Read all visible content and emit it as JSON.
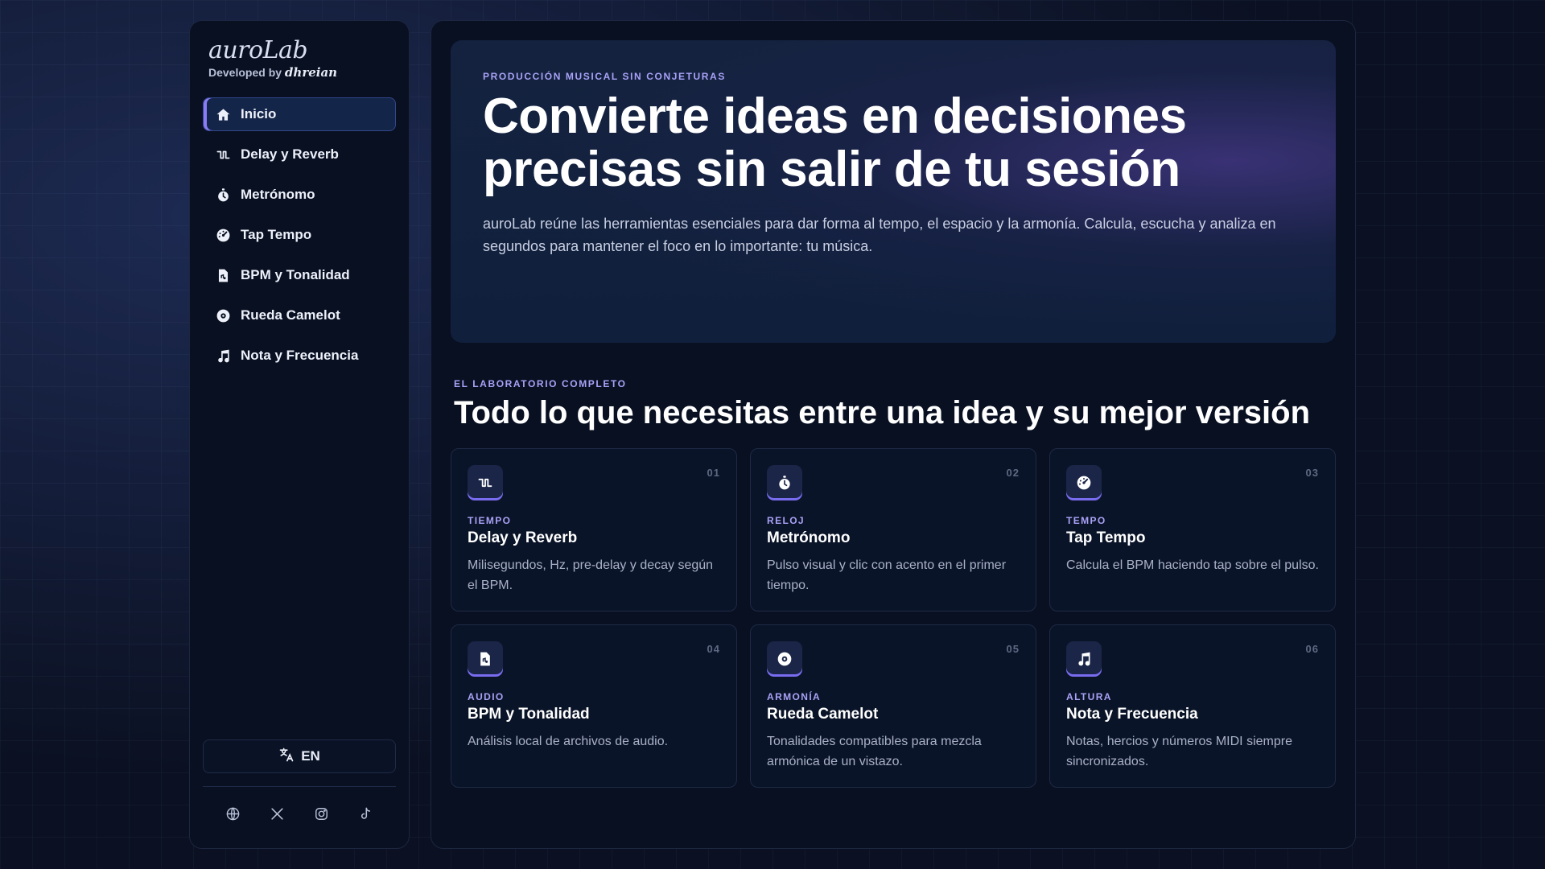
{
  "brand": {
    "name": "auroLab",
    "developed_by": "Developed by",
    "signature": "dhreian"
  },
  "sidebar": {
    "items": [
      {
        "label": "Inicio",
        "icon": "home-icon",
        "active": true
      },
      {
        "label": "Delay y Reverb",
        "icon": "waveform-icon"
      },
      {
        "label": "Metrónomo",
        "icon": "stopwatch-icon"
      },
      {
        "label": "Tap Tempo",
        "icon": "gauge-icon"
      },
      {
        "label": "BPM y Tonalidad",
        "icon": "audio-file-icon"
      },
      {
        "label": "Rueda Camelot",
        "icon": "disc-icon"
      },
      {
        "label": "Nota y Frecuencia",
        "icon": "music-note-icon"
      }
    ],
    "language_button": "EN",
    "socials": [
      "globe-icon",
      "x-icon",
      "instagram-icon",
      "tiktok-icon"
    ]
  },
  "hero": {
    "eyebrow": "PRODUCCIÓN MUSICAL SIN CONJETURAS",
    "title": "Convierte ideas en decisiones precisas sin salir de tu sesión",
    "description": "auroLab reúne las herramientas esenciales para dar forma al tempo, el espacio y la armonía. Calcula, escucha y analiza en segundos para mantener el foco en lo importante: tu música."
  },
  "features": {
    "eyebrow": "EL LABORATORIO COMPLETO",
    "title": "Todo lo que necesitas entre una idea y su mejor versión",
    "cards": [
      {
        "num": "01",
        "tag": "TIEMPO",
        "title": "Delay y Reverb",
        "desc": "Milisegundos, Hz, pre-delay y decay según el BPM.",
        "icon": "waveform-icon"
      },
      {
        "num": "02",
        "tag": "RELOJ",
        "title": "Metrónomo",
        "desc": "Pulso visual y clic con acento en el primer tiempo.",
        "icon": "stopwatch-icon"
      },
      {
        "num": "03",
        "tag": "TEMPO",
        "title": "Tap Tempo",
        "desc": "Calcula el BPM haciendo tap sobre el pulso.",
        "icon": "gauge-icon"
      },
      {
        "num": "04",
        "tag": "AUDIO",
        "title": "BPM y Tonalidad",
        "desc": "Análisis local de archivos de audio.",
        "icon": "audio-file-icon"
      },
      {
        "num": "05",
        "tag": "ARMONÍA",
        "title": "Rueda Camelot",
        "desc": "Tonalidades compatibles para mezcla armónica de un vistazo.",
        "icon": "disc-icon"
      },
      {
        "num": "06",
        "tag": "ALTURA",
        "title": "Nota y Frecuencia",
        "desc": "Notas, hercios y números MIDI siempre sincronizados.",
        "icon": "music-note-icon"
      }
    ]
  },
  "colors": {
    "accent": "#8a7cf5",
    "eyebrow": "#a9a2f7",
    "panel": "#081022",
    "background": "#0b1122"
  }
}
